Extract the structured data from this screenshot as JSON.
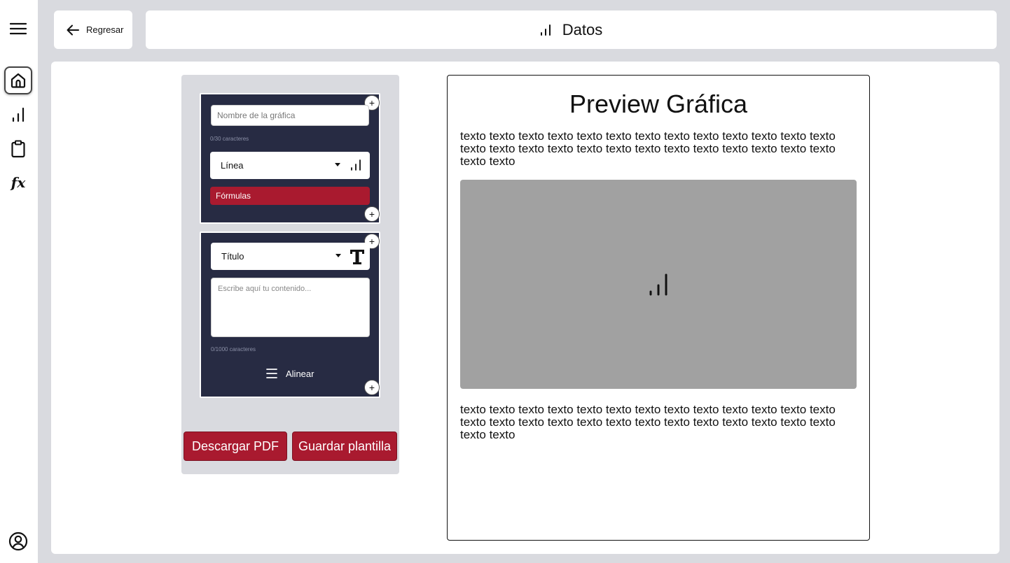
{
  "nav": {
    "items": [
      {
        "icon": "menu-icon"
      },
      {
        "icon": "home-icon",
        "active": true
      },
      {
        "icon": "chart-icon"
      },
      {
        "icon": "clipboard-icon"
      },
      {
        "icon": "function-icon",
        "label": "fx"
      }
    ],
    "profile_icon": "user-circle-icon"
  },
  "header": {
    "back_label": "Regresar",
    "title": "Datos"
  },
  "editor": {
    "chart_block": {
      "name_placeholder": "Nombre de la gráfica",
      "name_counter": "0/30 caracteres",
      "type_selected": "Línea",
      "formulas_label": "Fórmulas"
    },
    "text_block": {
      "type_selected": "Título",
      "content_placeholder": "Escribe aquí tu contenido...",
      "content_counter": "0/1000 caracteres",
      "align_label": "Alinear"
    },
    "add_symbol": "+",
    "download_pdf_label": "Descargar PDF",
    "save_template_label": "Guardar plantilla"
  },
  "preview": {
    "title": "Preview Gráfica",
    "paragraph_top": "texto texto texto texto texto texto texto texto texto texto texto texto texto texto texto texto texto texto texto texto texto texto texto texto texto texto texto texto",
    "paragraph_bottom": "texto texto texto texto texto texto texto texto texto texto texto texto texto texto texto texto texto texto texto texto texto texto texto texto texto texto texto texto"
  },
  "colors": {
    "accent": "#a91a2f",
    "block_bg": "#272b43",
    "page_bg": "#d9dadf",
    "chart_placeholder": "#a1a1a1"
  }
}
